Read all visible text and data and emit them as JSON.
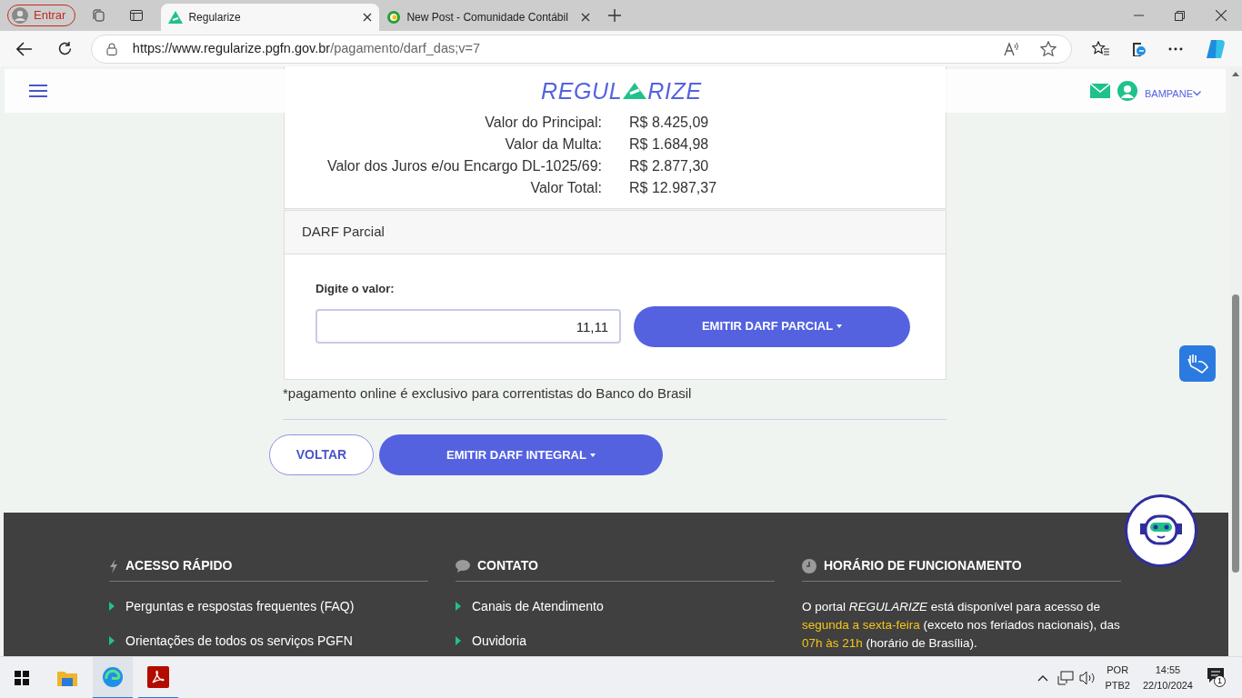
{
  "browser": {
    "profile_label": "Entrar",
    "tabs": [
      {
        "title": "Regularize",
        "selected": true
      },
      {
        "title": "New Post - Comunidade Contábil",
        "selected": false
      }
    ],
    "url_host": "https://www.regularize.pgfn.gov.br",
    "url_path": "/pagamento/darf_das;v=7"
  },
  "header": {
    "logo_left": "REGUL",
    "logo_right": "RIZE",
    "user": "BAMPANE"
  },
  "summary": [
    {
      "label": "Valor do Principal:",
      "value": "R$ 8.425,09"
    },
    {
      "label": "Valor da Multa:",
      "value": "R$ 1.684,98"
    },
    {
      "label": "Valor dos Juros e/ou Encargo DL-1025/69:",
      "value": "R$ 2.877,30"
    },
    {
      "label": "Valor Total:",
      "value": "R$ 12.987,37"
    }
  ],
  "partial": {
    "title": "DARF Parcial",
    "field_label": "Digite o valor:",
    "value": "11,11",
    "button": "EMITIR DARF PARCIAL"
  },
  "note": "*pagamento online é exclusivo para correntistas do Banco do Brasil",
  "actions": {
    "back": "VOLTAR",
    "primary": "EMITIR DARF INTEGRAL"
  },
  "footer": [
    {
      "kind": "links",
      "title": "ACESSO RÁPIDO",
      "items": [
        "Perguntas e respostas frequentes (FAQ)",
        "Orientações de todos os serviços PGFN"
      ]
    },
    {
      "kind": "links",
      "title": "CONTATO",
      "items": [
        "Canais de Atendimento",
        "Ouvidoria"
      ]
    },
    {
      "kind": "text",
      "title": "HORÁRIO DE FUNCIONAMENTO",
      "text": "O portal *REGULARIZE* está disponível para acesso de **segunda a sexta-feira** (exceto nos feriados nacionais), das **07h às 21h** (horário de Brasília)."
    }
  ],
  "taskbar": {
    "lang_top": "POR",
    "lang_bottom": "PTB2",
    "time": "14:55",
    "date": "22/10/2024",
    "notifications": "1"
  }
}
